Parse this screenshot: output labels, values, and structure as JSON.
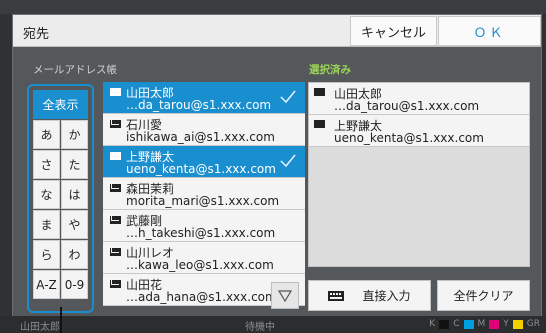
{
  "dialog": {
    "title": "宛先",
    "cancel_label": "キャンセル",
    "ok_label": "ＯＫ"
  },
  "address_book": {
    "label": "メールアドレス帳",
    "index": {
      "all_label": "全表示",
      "buttons": [
        "あ",
        "か",
        "さ",
        "た",
        "な",
        "は",
        "ま",
        "や",
        "ら",
        "わ",
        "A-Z",
        "0-9"
      ]
    },
    "entries": [
      {
        "name": "山田太郎",
        "email": "…da_tarou@s1.xxx.com",
        "selected": true
      },
      {
        "name": "石川愛",
        "email": "ishikawa_ai@s1.xxx.com",
        "selected": false
      },
      {
        "name": "上野謙太",
        "email": "ueno_kenta@s1.xxx.com",
        "selected": true
      },
      {
        "name": "森田茉莉",
        "email": "morita_mari@s1.xxx.com",
        "selected": false
      },
      {
        "name": "武藤剛",
        "email": "…h_takeshi@s1.xxx.com",
        "selected": false
      },
      {
        "name": "山川レオ",
        "email": "…kawa_leo@s1.xxx.com",
        "selected": false
      },
      {
        "name": "山田花",
        "email": "…ada_hana@s1.xxx.com",
        "selected": false
      }
    ]
  },
  "selected": {
    "label": "選択済み",
    "entries": [
      {
        "name": "山田太郎",
        "email": "…da_tarou@s1.xxx.com"
      },
      {
        "name": "上野謙太",
        "email": "ueno_kenta@s1.xxx.com"
      }
    ],
    "direct_input_label": "直接入力",
    "clear_all_label": "全件クリア"
  },
  "status_bar": {
    "left_text": "山田太郎",
    "mid_text": "待機中",
    "ink_labels": [
      "K",
      "C",
      "M",
      "Y",
      "GR"
    ],
    "ink_colors": [
      "#111111",
      "#00a0e0",
      "#e0007a",
      "#f5d000",
      "#9aa0a4"
    ]
  },
  "colors": {
    "accent": "#1a8fd0",
    "selected_label": "#9bd35a"
  }
}
